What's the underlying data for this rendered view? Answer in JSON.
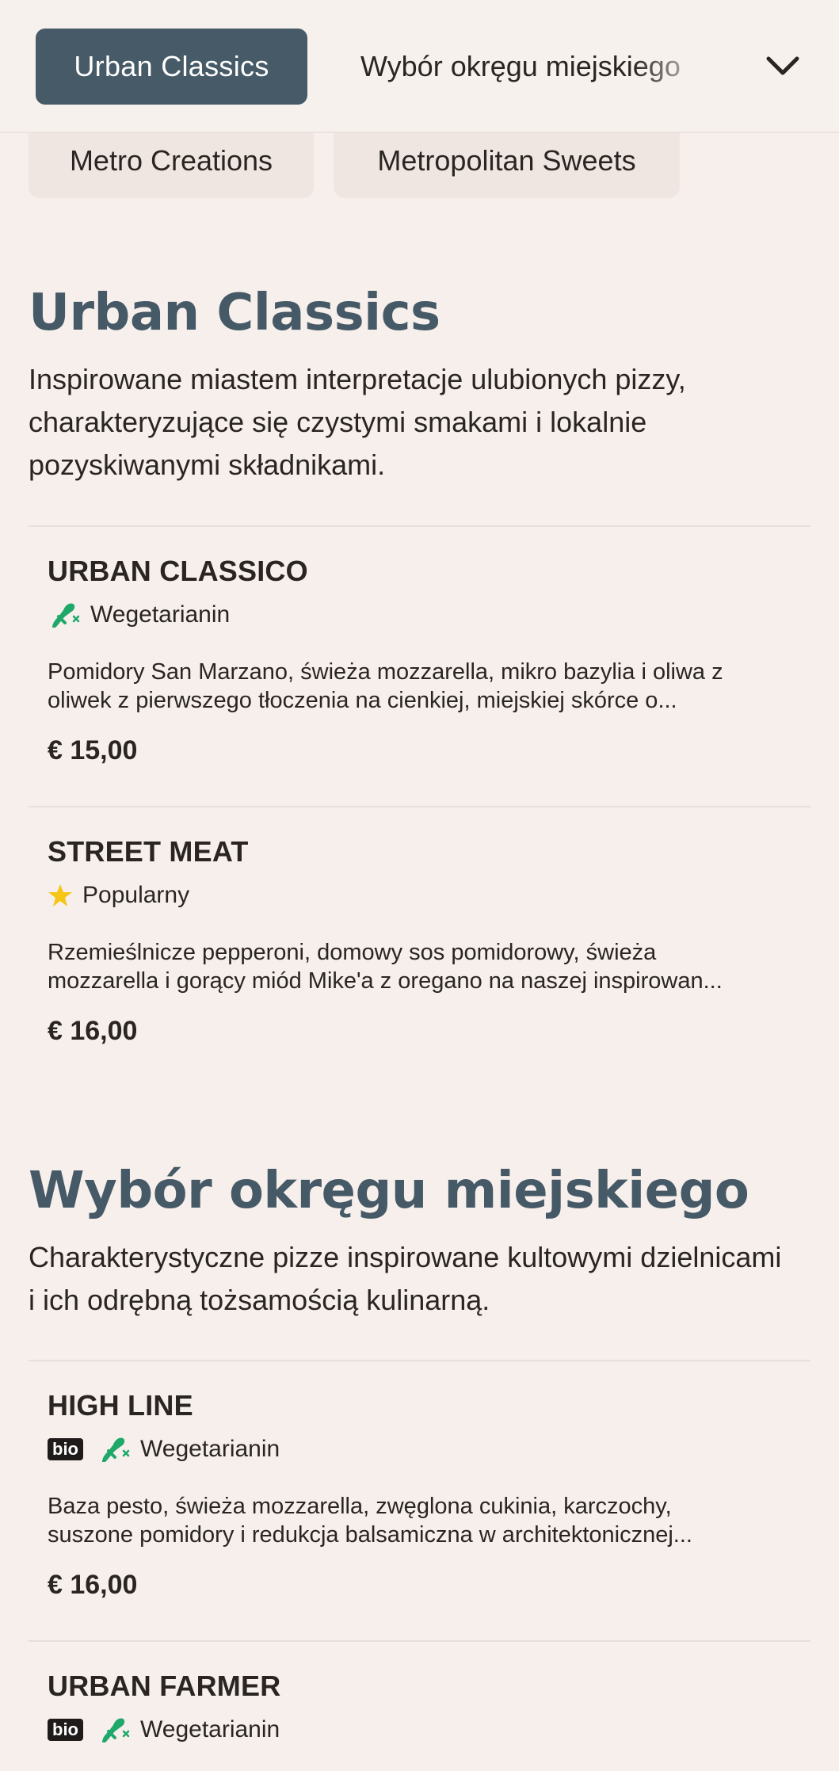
{
  "nav": {
    "active_tab": "Urban Classics",
    "next_tab": "Wybór okręgu miejskiego",
    "more_tabs": [
      "Metro Creations",
      "Metropolitan Sweets"
    ]
  },
  "sections": [
    {
      "title": "Urban Classics",
      "description": "Inspirowane miastem interpretacje ulubionych pizzy, charakteryzujące się czystymi smakami i lokalnie pozyskiwanymi składnikami.",
      "items": [
        {
          "name": "URBAN CLASSICO",
          "bio": "",
          "tag": "Wegetarianin",
          "tag_icon": "vegetarian-icon",
          "desc_line1": "Pomidory San Marzano, świeża mozzarella, mikro bazylia i oliwa z",
          "desc_line2": "oliwek z pierwszego tłoczenia na cienkiej, miejskiej skórce o...",
          "price": "€ 15,00"
        },
        {
          "name": "STREET MEAT",
          "bio": "",
          "tag": "Popularny",
          "tag_icon": "star-icon",
          "desc_line1": "Rzemieślnicze pepperoni, domowy sos pomidorowy, świeża",
          "desc_line2": "mozzarella i gorący miód Mike'a z oregano na naszej inspirowan...",
          "price": "€ 16,00"
        }
      ]
    },
    {
      "title": "Wybór okręgu miejskiego",
      "description": "Charakterystyczne pizze inspirowane kultowymi dzielnicami i ich odrębną tożsamością kulinarną.",
      "items": [
        {
          "name": "HIGH LINE",
          "bio": "bio",
          "tag": "Wegetarianin",
          "tag_icon": "vegetarian-icon",
          "desc_line1": "Baza pesto, świeża mozzarella, zwęglona cukinia, karczochy,",
          "desc_line2": "suszone pomidory i redukcja balsamiczna w architektonicznej...",
          "price": "€ 16,00"
        },
        {
          "name": "URBAN FARMER",
          "bio": "bio",
          "tag": "Wegetarianin",
          "tag_icon": "vegetarian-icon"
        }
      ]
    }
  ],
  "colors": {
    "background": "#f6efeb",
    "accent": "#475a67",
    "vegetarian_icon": "#1fa86a",
    "star_icon": "#f5c518"
  }
}
